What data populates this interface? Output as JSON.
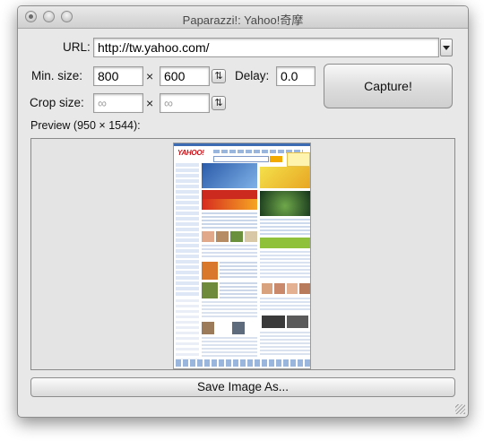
{
  "window": {
    "title": "Paparazzi!: Yahoo!奇摩"
  },
  "form": {
    "url_label": "URL:",
    "url_value": "http://tw.yahoo.com/",
    "min_size_label": "Min. size:",
    "min_width": "800",
    "min_height": "600",
    "delay_label": "Delay:",
    "delay_value": "0.0",
    "crop_size_label": "Crop size:",
    "crop_width_placeholder": "∞",
    "crop_height_placeholder": "∞",
    "times_symbol": "×",
    "capture_label": "Capture!"
  },
  "preview": {
    "label": "Preview (950 × 1544):",
    "thumbnail": {
      "logo": "YAHOO!"
    }
  },
  "footer": {
    "save_label": "Save Image As..."
  },
  "icons": {
    "swap": "swap-icon",
    "dropdown": "chevron-down-icon",
    "resize": "resize-grip-icon"
  }
}
